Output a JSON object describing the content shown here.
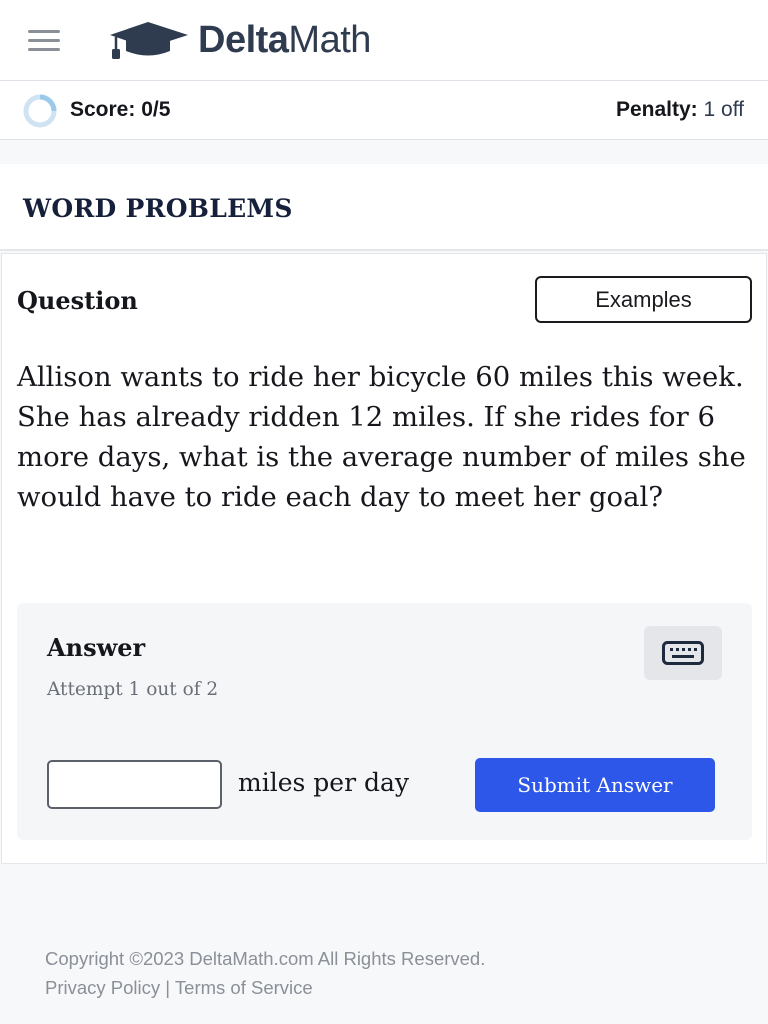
{
  "header": {
    "menu_icon": "hamburger-menu-icon",
    "logo_icon": "graduation-cap-icon",
    "brand_bold": "Delta",
    "brand_regular": "Math"
  },
  "scorebar": {
    "progress_icon": "loading-spinner-icon",
    "score": "Score: 0/5",
    "penalty_label": "Penalty:",
    "penalty_value": "1 off"
  },
  "section": {
    "title": "WORD PROBLEMS"
  },
  "question": {
    "label": "Question",
    "examples_label": "Examples",
    "text": "Allison wants to ride her bicycle 60 miles this week. She has already ridden 12 miles. If she rides for 6 more days, what is the average number of miles she would have to ride each day to meet her goal?"
  },
  "answer": {
    "label": "Answer",
    "attempt": "Attempt 1 out of 2",
    "keyboard_icon": "keyboard-icon",
    "input_value": "",
    "units": "miles per day",
    "submit_label": "Submit Answer"
  },
  "footer": {
    "copyright": "Copyright ©2023 DeltaMath.com All Rights Reserved.",
    "privacy": "Privacy Policy",
    "separator": "|",
    "terms": "Terms of Service"
  },
  "colors": {
    "accent": "#2c57e8",
    "brand_text": "#2f3b4f",
    "page_bg": "#f7f8fa"
  }
}
